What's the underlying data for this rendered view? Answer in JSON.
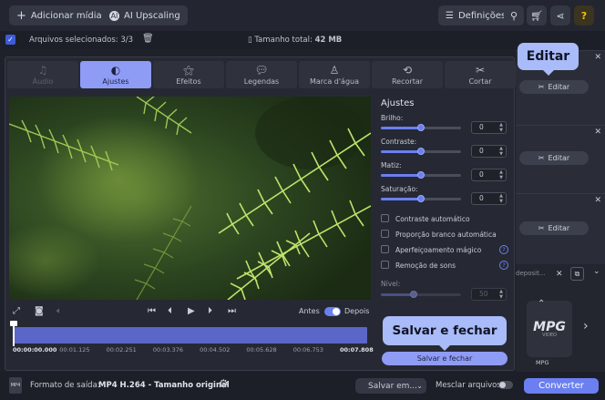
{
  "toolbar": {
    "add_media": "Adicionar mídia",
    "ai_upscaling": "AI Upscaling",
    "settings": "Definições",
    "help": "?"
  },
  "filebar": {
    "selected": "Arquivos selecionados: 3/3",
    "total_size_label": "Tamanho total:",
    "total_size_value": "42 MB"
  },
  "file_list": {
    "items": [
      {
        "edit_label": "Editar"
      },
      {
        "edit_label": "Editar"
      },
      {
        "edit_label": "Editar"
      }
    ],
    "search_placeholder": "deposit..."
  },
  "editor": {
    "tabs": [
      {
        "label": "Áudio",
        "icon": "music-note-icon",
        "state": "disabled"
      },
      {
        "label": "Ajustes",
        "icon": "contrast-icon",
        "state": "active"
      },
      {
        "label": "Efeitos",
        "icon": "magic-wand-icon",
        "state": "normal"
      },
      {
        "label": "Legendas",
        "icon": "subtitles-icon",
        "state": "normal"
      },
      {
        "label": "Marca d'água",
        "icon": "stamp-icon",
        "state": "normal"
      },
      {
        "label": "Recortar",
        "icon": "crop-icon",
        "state": "normal"
      },
      {
        "label": "Cortar",
        "icon": "scissors-icon",
        "state": "normal"
      }
    ],
    "controls": {
      "before": "Antes",
      "after": "Depois",
      "toggle_on": true
    },
    "timeline": {
      "progress": 0.0,
      "labels": [
        "00:00:00.000",
        "00:01.125",
        "00:02.251",
        "00:03.376",
        "00:04.502",
        "00:05.628",
        "00:06.753",
        "00:07.808"
      ]
    },
    "adjust": {
      "title": "Ajustes",
      "sliders": [
        {
          "label": "Brilho:",
          "value": "0",
          "level": 0.5
        },
        {
          "label": "Contraste:",
          "value": "0",
          "level": 0.5
        },
        {
          "label": "Matiz:",
          "value": "0",
          "level": 0.5
        },
        {
          "label": "Saturação:",
          "value": "0",
          "level": 0.5
        }
      ],
      "options": [
        {
          "label": "Contraste automático",
          "help": false
        },
        {
          "label": "Proporção branco automática",
          "help": false
        },
        {
          "label": "Aperfeiçoamento mágico",
          "help": true
        },
        {
          "label": "Remoção de sons",
          "help": true
        }
      ],
      "level_label": "Nível:",
      "level_value": "50",
      "save_close": "Salvar e fechar"
    }
  },
  "callouts": {
    "edit": "Editar",
    "save_close": "Salvar e fechar"
  },
  "format": {
    "name": "MPG",
    "sub": "VIDEO",
    "label": "MPG"
  },
  "bottombar": {
    "output_label": "Formato de saída:",
    "output_value": "MP4 H.264 - Tamanho original",
    "save_in": "Salvar em...",
    "merge": "Mesclar arquivos:",
    "convert": "Converter"
  },
  "colors": {
    "accent": "#6b7ff0",
    "active_tab": "#8f9cf5",
    "callout": "#a9bbf8"
  }
}
